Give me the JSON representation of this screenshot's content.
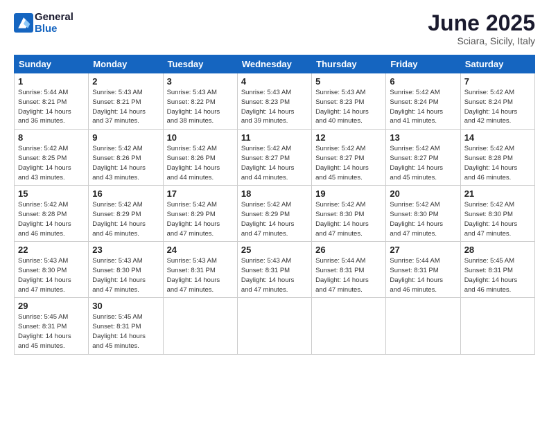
{
  "logo": {
    "line1": "General",
    "line2": "Blue"
  },
  "title": "June 2025",
  "subtitle": "Sciara, Sicily, Italy",
  "days_header": [
    "Sunday",
    "Monday",
    "Tuesday",
    "Wednesday",
    "Thursday",
    "Friday",
    "Saturday"
  ],
  "weeks": [
    [
      {
        "day": "1",
        "info": "Sunrise: 5:44 AM\nSunset: 8:21 PM\nDaylight: 14 hours\nand 36 minutes."
      },
      {
        "day": "2",
        "info": "Sunrise: 5:43 AM\nSunset: 8:21 PM\nDaylight: 14 hours\nand 37 minutes."
      },
      {
        "day": "3",
        "info": "Sunrise: 5:43 AM\nSunset: 8:22 PM\nDaylight: 14 hours\nand 38 minutes."
      },
      {
        "day": "4",
        "info": "Sunrise: 5:43 AM\nSunset: 8:23 PM\nDaylight: 14 hours\nand 39 minutes."
      },
      {
        "day": "5",
        "info": "Sunrise: 5:43 AM\nSunset: 8:23 PM\nDaylight: 14 hours\nand 40 minutes."
      },
      {
        "day": "6",
        "info": "Sunrise: 5:42 AM\nSunset: 8:24 PM\nDaylight: 14 hours\nand 41 minutes."
      },
      {
        "day": "7",
        "info": "Sunrise: 5:42 AM\nSunset: 8:24 PM\nDaylight: 14 hours\nand 42 minutes."
      }
    ],
    [
      {
        "day": "8",
        "info": "Sunrise: 5:42 AM\nSunset: 8:25 PM\nDaylight: 14 hours\nand 43 minutes."
      },
      {
        "day": "9",
        "info": "Sunrise: 5:42 AM\nSunset: 8:26 PM\nDaylight: 14 hours\nand 43 minutes."
      },
      {
        "day": "10",
        "info": "Sunrise: 5:42 AM\nSunset: 8:26 PM\nDaylight: 14 hours\nand 44 minutes."
      },
      {
        "day": "11",
        "info": "Sunrise: 5:42 AM\nSunset: 8:27 PM\nDaylight: 14 hours\nand 44 minutes."
      },
      {
        "day": "12",
        "info": "Sunrise: 5:42 AM\nSunset: 8:27 PM\nDaylight: 14 hours\nand 45 minutes."
      },
      {
        "day": "13",
        "info": "Sunrise: 5:42 AM\nSunset: 8:27 PM\nDaylight: 14 hours\nand 45 minutes."
      },
      {
        "day": "14",
        "info": "Sunrise: 5:42 AM\nSunset: 8:28 PM\nDaylight: 14 hours\nand 46 minutes."
      }
    ],
    [
      {
        "day": "15",
        "info": "Sunrise: 5:42 AM\nSunset: 8:28 PM\nDaylight: 14 hours\nand 46 minutes."
      },
      {
        "day": "16",
        "info": "Sunrise: 5:42 AM\nSunset: 8:29 PM\nDaylight: 14 hours\nand 46 minutes."
      },
      {
        "day": "17",
        "info": "Sunrise: 5:42 AM\nSunset: 8:29 PM\nDaylight: 14 hours\nand 47 minutes."
      },
      {
        "day": "18",
        "info": "Sunrise: 5:42 AM\nSunset: 8:29 PM\nDaylight: 14 hours\nand 47 minutes."
      },
      {
        "day": "19",
        "info": "Sunrise: 5:42 AM\nSunset: 8:30 PM\nDaylight: 14 hours\nand 47 minutes."
      },
      {
        "day": "20",
        "info": "Sunrise: 5:42 AM\nSunset: 8:30 PM\nDaylight: 14 hours\nand 47 minutes."
      },
      {
        "day": "21",
        "info": "Sunrise: 5:42 AM\nSunset: 8:30 PM\nDaylight: 14 hours\nand 47 minutes."
      }
    ],
    [
      {
        "day": "22",
        "info": "Sunrise: 5:43 AM\nSunset: 8:30 PM\nDaylight: 14 hours\nand 47 minutes."
      },
      {
        "day": "23",
        "info": "Sunrise: 5:43 AM\nSunset: 8:30 PM\nDaylight: 14 hours\nand 47 minutes."
      },
      {
        "day": "24",
        "info": "Sunrise: 5:43 AM\nSunset: 8:31 PM\nDaylight: 14 hours\nand 47 minutes."
      },
      {
        "day": "25",
        "info": "Sunrise: 5:43 AM\nSunset: 8:31 PM\nDaylight: 14 hours\nand 47 minutes."
      },
      {
        "day": "26",
        "info": "Sunrise: 5:44 AM\nSunset: 8:31 PM\nDaylight: 14 hours\nand 47 minutes."
      },
      {
        "day": "27",
        "info": "Sunrise: 5:44 AM\nSunset: 8:31 PM\nDaylight: 14 hours\nand 46 minutes."
      },
      {
        "day": "28",
        "info": "Sunrise: 5:45 AM\nSunset: 8:31 PM\nDaylight: 14 hours\nand 46 minutes."
      }
    ],
    [
      {
        "day": "29",
        "info": "Sunrise: 5:45 AM\nSunset: 8:31 PM\nDaylight: 14 hours\nand 45 minutes."
      },
      {
        "day": "30",
        "info": "Sunrise: 5:45 AM\nSunset: 8:31 PM\nDaylight: 14 hours\nand 45 minutes."
      },
      {
        "day": "",
        "info": ""
      },
      {
        "day": "",
        "info": ""
      },
      {
        "day": "",
        "info": ""
      },
      {
        "day": "",
        "info": ""
      },
      {
        "day": "",
        "info": ""
      }
    ]
  ]
}
